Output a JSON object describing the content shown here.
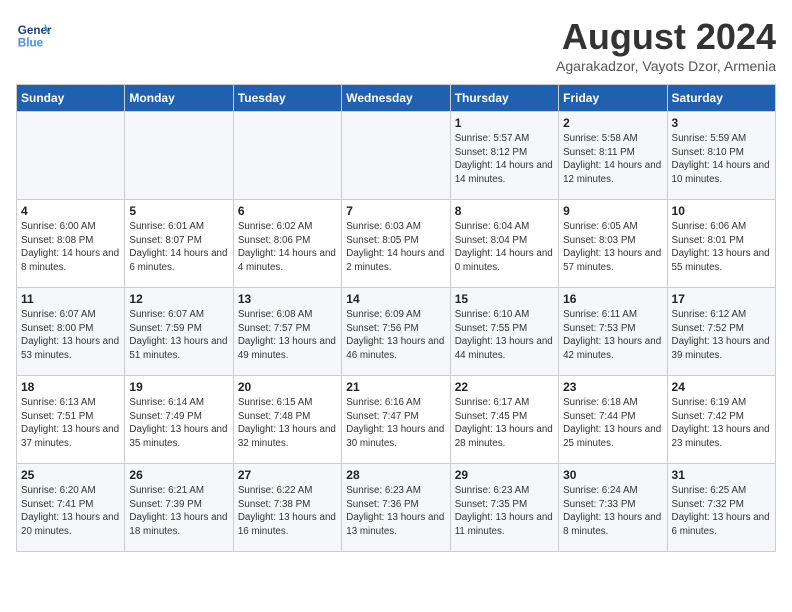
{
  "header": {
    "logo_line1": "General",
    "logo_line2": "Blue",
    "month_title": "August 2024",
    "subtitle": "Agarakadzor, Vayots Dzor, Armenia"
  },
  "weekdays": [
    "Sunday",
    "Monday",
    "Tuesday",
    "Wednesday",
    "Thursday",
    "Friday",
    "Saturday"
  ],
  "weeks": [
    [
      {
        "day": "",
        "info": ""
      },
      {
        "day": "",
        "info": ""
      },
      {
        "day": "",
        "info": ""
      },
      {
        "day": "",
        "info": ""
      },
      {
        "day": "1",
        "info": "Sunrise: 5:57 AM\nSunset: 8:12 PM\nDaylight: 14 hours and 14 minutes."
      },
      {
        "day": "2",
        "info": "Sunrise: 5:58 AM\nSunset: 8:11 PM\nDaylight: 14 hours and 12 minutes."
      },
      {
        "day": "3",
        "info": "Sunrise: 5:59 AM\nSunset: 8:10 PM\nDaylight: 14 hours and 10 minutes."
      }
    ],
    [
      {
        "day": "4",
        "info": "Sunrise: 6:00 AM\nSunset: 8:08 PM\nDaylight: 14 hours and 8 minutes."
      },
      {
        "day": "5",
        "info": "Sunrise: 6:01 AM\nSunset: 8:07 PM\nDaylight: 14 hours and 6 minutes."
      },
      {
        "day": "6",
        "info": "Sunrise: 6:02 AM\nSunset: 8:06 PM\nDaylight: 14 hours and 4 minutes."
      },
      {
        "day": "7",
        "info": "Sunrise: 6:03 AM\nSunset: 8:05 PM\nDaylight: 14 hours and 2 minutes."
      },
      {
        "day": "8",
        "info": "Sunrise: 6:04 AM\nSunset: 8:04 PM\nDaylight: 14 hours and 0 minutes."
      },
      {
        "day": "9",
        "info": "Sunrise: 6:05 AM\nSunset: 8:03 PM\nDaylight: 13 hours and 57 minutes."
      },
      {
        "day": "10",
        "info": "Sunrise: 6:06 AM\nSunset: 8:01 PM\nDaylight: 13 hours and 55 minutes."
      }
    ],
    [
      {
        "day": "11",
        "info": "Sunrise: 6:07 AM\nSunset: 8:00 PM\nDaylight: 13 hours and 53 minutes."
      },
      {
        "day": "12",
        "info": "Sunrise: 6:07 AM\nSunset: 7:59 PM\nDaylight: 13 hours and 51 minutes."
      },
      {
        "day": "13",
        "info": "Sunrise: 6:08 AM\nSunset: 7:57 PM\nDaylight: 13 hours and 49 minutes."
      },
      {
        "day": "14",
        "info": "Sunrise: 6:09 AM\nSunset: 7:56 PM\nDaylight: 13 hours and 46 minutes."
      },
      {
        "day": "15",
        "info": "Sunrise: 6:10 AM\nSunset: 7:55 PM\nDaylight: 13 hours and 44 minutes."
      },
      {
        "day": "16",
        "info": "Sunrise: 6:11 AM\nSunset: 7:53 PM\nDaylight: 13 hours and 42 minutes."
      },
      {
        "day": "17",
        "info": "Sunrise: 6:12 AM\nSunset: 7:52 PM\nDaylight: 13 hours and 39 minutes."
      }
    ],
    [
      {
        "day": "18",
        "info": "Sunrise: 6:13 AM\nSunset: 7:51 PM\nDaylight: 13 hours and 37 minutes."
      },
      {
        "day": "19",
        "info": "Sunrise: 6:14 AM\nSunset: 7:49 PM\nDaylight: 13 hours and 35 minutes."
      },
      {
        "day": "20",
        "info": "Sunrise: 6:15 AM\nSunset: 7:48 PM\nDaylight: 13 hours and 32 minutes."
      },
      {
        "day": "21",
        "info": "Sunrise: 6:16 AM\nSunset: 7:47 PM\nDaylight: 13 hours and 30 minutes."
      },
      {
        "day": "22",
        "info": "Sunrise: 6:17 AM\nSunset: 7:45 PM\nDaylight: 13 hours and 28 minutes."
      },
      {
        "day": "23",
        "info": "Sunrise: 6:18 AM\nSunset: 7:44 PM\nDaylight: 13 hours and 25 minutes."
      },
      {
        "day": "24",
        "info": "Sunrise: 6:19 AM\nSunset: 7:42 PM\nDaylight: 13 hours and 23 minutes."
      }
    ],
    [
      {
        "day": "25",
        "info": "Sunrise: 6:20 AM\nSunset: 7:41 PM\nDaylight: 13 hours and 20 minutes."
      },
      {
        "day": "26",
        "info": "Sunrise: 6:21 AM\nSunset: 7:39 PM\nDaylight: 13 hours and 18 minutes."
      },
      {
        "day": "27",
        "info": "Sunrise: 6:22 AM\nSunset: 7:38 PM\nDaylight: 13 hours and 16 minutes."
      },
      {
        "day": "28",
        "info": "Sunrise: 6:23 AM\nSunset: 7:36 PM\nDaylight: 13 hours and 13 minutes."
      },
      {
        "day": "29",
        "info": "Sunrise: 6:23 AM\nSunset: 7:35 PM\nDaylight: 13 hours and 11 minutes."
      },
      {
        "day": "30",
        "info": "Sunrise: 6:24 AM\nSunset: 7:33 PM\nDaylight: 13 hours and 8 minutes."
      },
      {
        "day": "31",
        "info": "Sunrise: 6:25 AM\nSunset: 7:32 PM\nDaylight: 13 hours and 6 minutes."
      }
    ]
  ]
}
